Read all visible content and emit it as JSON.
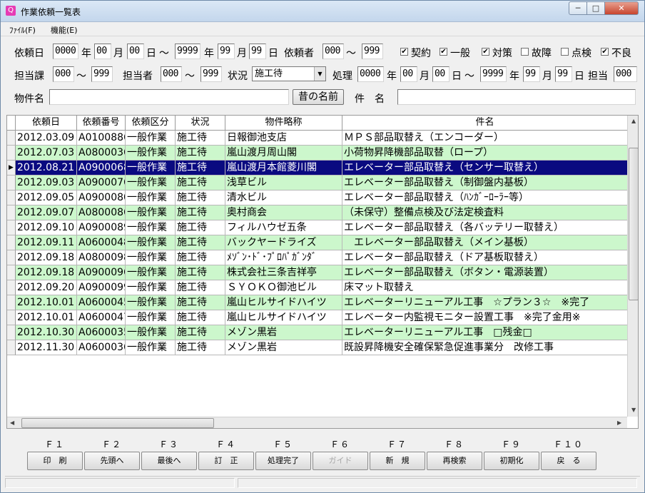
{
  "window": {
    "title": "作業依頼一覧表",
    "app_icon": "Q",
    "min": "─",
    "max": "□",
    "close": "✕"
  },
  "menu": [
    {
      "label": "ﾌｧｲﾙ(F)"
    },
    {
      "label": "機能(E)"
    }
  ],
  "filters": {
    "irai_date_label": "依頼日",
    "irai_from_y": "0000",
    "irai_from_m": "00",
    "irai_from_d": "00",
    "irai_to_y": "9999",
    "irai_to_m": "99",
    "irai_to_d": "99",
    "year": "年",
    "month": "月",
    "day": "日",
    "tilde": "～",
    "iraisha_label": "依頼者",
    "iraisha_from": "000",
    "iraisha_to": "999",
    "checks": [
      {
        "label": "契約",
        "checked": true
      },
      {
        "label": "一般",
        "checked": true
      },
      {
        "label": "対策",
        "checked": true
      },
      {
        "label": "故障",
        "checked": false
      },
      {
        "label": "点検",
        "checked": false
      },
      {
        "label": "不良",
        "checked": true
      }
    ],
    "tantoka_label": "担当課",
    "tantoka_from": "000",
    "tantoka_to": "999",
    "tantosha_label": "担当者",
    "tantosha_from": "000",
    "tantosha_to": "999",
    "status_label": "状況",
    "status_value": "施工待",
    "status_arrow": "▼",
    "shori_label": "処理",
    "shori_from_y": "0000",
    "shori_from_m": "00",
    "shori_from_d": "00",
    "shori_to_y": "9999",
    "shori_to_m": "99",
    "shori_to_d": "99",
    "tanto_label": "担当",
    "tanto_value": "000",
    "bukken_label": "物件名",
    "bukken_value": "",
    "old_name_button": "昔の名前",
    "kenmei_label": "件　名",
    "kenmei_value": ""
  },
  "grid": {
    "columns": [
      "依頼日",
      "依頼番号",
      "依頼区分",
      "状況",
      "物件略称",
      "件名"
    ],
    "selected_row": 2,
    "row_marker": "▶",
    "rows": [
      {
        "date": "2012.03.09",
        "no": "A0100886",
        "kubun": "一般作業",
        "status": "施工待",
        "bukken": "日報御池支店",
        "kenmei": "ＭＰＳ部品取替え（エンコーダー）",
        "hl": false
      },
      {
        "date": "2012.07.03",
        "no": "A0800036",
        "kubun": "一般作業",
        "status": "施工待",
        "bukken": "嵐山渡月周山閣",
        "kenmei": "小荷物昇降機部品取替（ロープ）",
        "hl": true
      },
      {
        "date": "2012.08.21",
        "no": "A0900068",
        "kubun": "一般作業",
        "status": "施工待",
        "bukken": "嵐山渡月本館菱川閣",
        "kenmei": "エレベーター部品取替え（センサー取替え）",
        "hl": false
      },
      {
        "date": "2012.09.03",
        "no": "A0900076",
        "kubun": "一般作業",
        "status": "施工待",
        "bukken": "浅草ビル",
        "kenmei": "エレベーター部品取替え（制御盤内基板）",
        "hl": true
      },
      {
        "date": "2012.09.05",
        "no": "A0900080",
        "kubun": "一般作業",
        "status": "施工待",
        "bukken": "清水ビル",
        "kenmei": "エレベーター部品取替え（ﾊﾝｶﾞｰﾛｰﾗｰ等）",
        "hl": false
      },
      {
        "date": "2012.09.07",
        "no": "A0800086",
        "kubun": "一般作業",
        "status": "施工待",
        "bukken": "奥村商会",
        "kenmei": "（未保守）整備点検及び法定検査料",
        "hl": true
      },
      {
        "date": "2012.09.10",
        "no": "A0900089",
        "kubun": "一般作業",
        "status": "施工待",
        "bukken": "フィルハウゼ五条",
        "kenmei": "エレベーター部品取替え（各バッテリー取替え）",
        "hl": false
      },
      {
        "date": "2012.09.11",
        "no": "A0600048",
        "kubun": "一般作業",
        "status": "施工待",
        "bukken": "バックヤードライズ",
        "kenmei": "　エレベーター部品取替え（メイン基板）",
        "hl": true
      },
      {
        "date": "2012.09.18",
        "no": "A0800098",
        "kubun": "一般作業",
        "status": "施工待",
        "bukken": "ﾒｿﾞﾝ･ﾄﾞ･ﾌﾟﾛﾊﾟｶﾞﾝﾀﾞ",
        "kenmei": "エレベーター部品取替え（ドア基板取替え）",
        "hl": false
      },
      {
        "date": "2012.09.18",
        "no": "A0900096",
        "kubun": "一般作業",
        "status": "施工待",
        "bukken": "株式会社三条吉祥亭",
        "kenmei": "エレベーター部品取替え（ボタン・電源装置）",
        "hl": true
      },
      {
        "date": "2012.09.20",
        "no": "A0900099",
        "kubun": "一般作業",
        "status": "施工待",
        "bukken": "ＳＹＯＫＯ御池ビル",
        "kenmei": "床マット取替え",
        "hl": false
      },
      {
        "date": "2012.10.01",
        "no": "A0600045",
        "kubun": "一般作業",
        "status": "施工待",
        "bukken": "嵐山ヒルサイドハイツ",
        "kenmei": "エレベーターリニューアル工事　☆プラン３☆　※完了",
        "hl": true
      },
      {
        "date": "2012.10.01",
        "no": "A0600047",
        "kubun": "一般作業",
        "status": "施工待",
        "bukken": "嵐山ヒルサイドハイツ",
        "kenmei": "エレベーター内監視モニター設置工事　※完了金用※",
        "hl": false
      },
      {
        "date": "2012.10.30",
        "no": "A0600035",
        "kubun": "一般作業",
        "status": "施工待",
        "bukken": "メゾン黒岩",
        "kenmei": "エレベーターリニューアル工事　□残金□",
        "hl": true
      },
      {
        "date": "2012.11.30",
        "no": "A0600036",
        "kubun": "一般作業",
        "status": "施工待",
        "bukken": "メゾン黒岩",
        "kenmei": "既設昇降機安全確保緊急促進事業分　改修工事",
        "hl": false
      }
    ]
  },
  "scroll": {
    "up": "▲",
    "down": "▼",
    "left": "◀",
    "right": "▶"
  },
  "fkeys": [
    {
      "key": "Ｆ１",
      "label": "印　刷",
      "enabled": true
    },
    {
      "key": "Ｆ２",
      "label": "先頭へ",
      "enabled": true
    },
    {
      "key": "Ｆ３",
      "label": "最後へ",
      "enabled": true
    },
    {
      "key": "Ｆ４",
      "label": "訂　正",
      "enabled": true
    },
    {
      "key": "Ｆ５",
      "label": "処理完了",
      "enabled": true
    },
    {
      "key": "Ｆ６",
      "label": "ガイド",
      "enabled": false
    },
    {
      "key": "Ｆ７",
      "label": "新　規",
      "enabled": true
    },
    {
      "key": "Ｆ８",
      "label": "再検索",
      "enabled": true
    },
    {
      "key": "Ｆ９",
      "label": "初期化",
      "enabled": true
    },
    {
      "key": "Ｆ１０",
      "label": "戻　る",
      "enabled": true
    }
  ],
  "colors": {
    "highlight": "#ccf7cc",
    "selected": "#0a0a80",
    "selected_text": "#ffffff"
  }
}
